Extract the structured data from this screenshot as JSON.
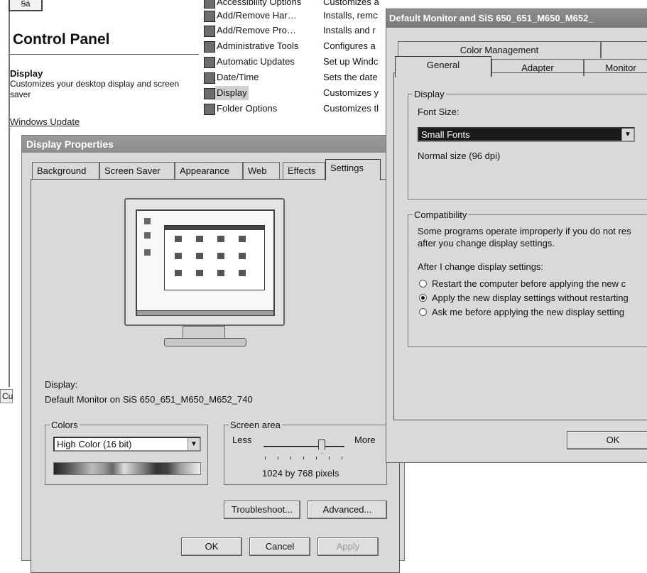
{
  "control_panel": {
    "header_icon_text": "Ꞩā",
    "title": "Control Panel",
    "display_heading": "Display",
    "display_description": "Customizes your desktop display and screen saver",
    "windows_update_link": "Windows Update",
    "items": [
      {
        "name": "Accessibility Options",
        "desc": "Customizes a"
      },
      {
        "name": "Add/Remove Har…",
        "desc": "Installs, remc"
      },
      {
        "name": "Add/Remove Pro…",
        "desc": "Installs and r"
      },
      {
        "name": "Administrative Tools",
        "desc": "Configures a"
      },
      {
        "name": "Automatic Updates",
        "desc": "Set up Windc"
      },
      {
        "name": "Date/Time",
        "desc": "Sets the date"
      },
      {
        "name": "Display",
        "desc": "Customizes y"
      },
      {
        "name": "Folder Options",
        "desc": "Customizes tl"
      }
    ],
    "cut_tab_text": "Cu"
  },
  "display_properties": {
    "title": "Display Properties",
    "help": "?",
    "tabs": [
      "Background",
      "Screen Saver",
      "Appearance",
      "Web",
      "Effects",
      "Settings"
    ],
    "active_tab": "Settings",
    "display_label": "Display:",
    "display_value": "Default Monitor on SiS 650_651_M650_M652_740",
    "colors_label": "Colors",
    "colors_value": "High Color (16 bit)",
    "screen_area_label": "Screen area",
    "less_label": "Less",
    "more_label": "More",
    "resolution": "1024 by 768 pixels",
    "slider_position": 0.72,
    "troubleshoot_button": "Troubleshoot...",
    "advanced_button": "Advanced...",
    "ok_button": "OK",
    "cancel_button": "Cancel",
    "apply_button": "Apply"
  },
  "monitor_properties": {
    "title": "Default Monitor and SiS 650_651_M650_M652_",
    "tabs_row1": [
      "Color Management"
    ],
    "tabs_row2": [
      "General",
      "Adapter",
      "Monitor"
    ],
    "active_tab": "General",
    "display_group": "Display",
    "font_size_label": "Font Size:",
    "font_size_value": "Small Fonts",
    "font_note": "Normal size (96 dpi)",
    "compat_group": "Compatibility",
    "compat_text_1": "Some programs operate improperly if you do not res",
    "compat_text_2": "after you change display settings.",
    "after_label": "After I change display settings:",
    "options": [
      {
        "label": "Restart the computer before applying the new c",
        "selected": false
      },
      {
        "label": "Apply the new display settings without restarting",
        "selected": true
      },
      {
        "label": "Ask me before applying the new display setting",
        "selected": false
      }
    ],
    "ok_button": "OK"
  }
}
